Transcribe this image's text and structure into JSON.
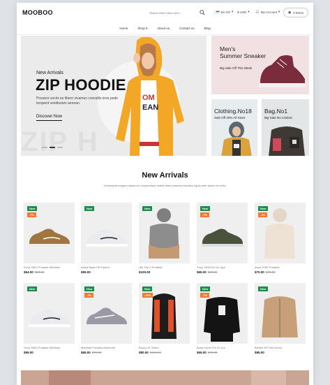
{
  "header": {
    "logo": "MOOBOO",
    "search_placeholder": "Search entire store here...",
    "language": "En-Gb",
    "currency": "$ USD",
    "account": "My Account",
    "wishlist": "0 Items"
  },
  "nav": [
    "Home",
    "Shop",
    "About us",
    "Contact us",
    "Blog"
  ],
  "hero": {
    "subtitle": "New Arrivals",
    "title": "ZIP HOODIE",
    "description": "Posuere sociis eu libero vivamus convallis eros pede torquent vestibulum aenean.",
    "button": "Discover Now",
    "ghost_text": "ZIP H"
  },
  "banners": [
    {
      "title": "Men's\nSummer Sneaker",
      "title_line1": "Men's",
      "title_line2": "Summer Sneaker",
      "subtitle": "Big Sale Off This Week"
    },
    {
      "title": "Clothing.No18",
      "subtitle": "Sale Off 20% All Store"
    },
    {
      "title": "Bag.No1",
      "subtitle": "Big Sale No Limited"
    }
  ],
  "section": {
    "title": "New Arrivals",
    "subtitle": "Consequat magna massa vel suspendisse mattis diam pharetra faucibus ligula ante ipsum ac nulla."
  },
  "products": [
    {
      "name": "Sony X800 Portable Wireless",
      "price": "$64.00",
      "old": "$88.00",
      "new": "New",
      "sale": "-7%",
      "icon": "brown-sneaker-icon"
    },
    {
      "name": "Nokia Basic HR Hybrid",
      "price": "$95.00",
      "old": "",
      "new": "New",
      "sale": "",
      "icon": "white-sneaker-icon"
    },
    {
      "name": "JBL Flip 5 Portable",
      "price": "$100.00",
      "old": "",
      "new": "New",
      "sale": "",
      "icon": "grey-hoodie-icon"
    },
    {
      "name": "Sony XB32/33 Ult Joyli",
      "price": "$65.00",
      "old": "$88.00",
      "new": "New",
      "sale": "-7%",
      "icon": "olive-sneaker-icon"
    },
    {
      "name": "Asus ZF8P Portable",
      "price": "$70.00",
      "old": "$75.00",
      "new": "New",
      "sale": "-7%",
      "icon": "cream-hoodie-icon"
    },
    {
      "name": "Sony X800 Portable Wireless",
      "price": "$95.00",
      "old": "",
      "new": "New",
      "sale": "",
      "icon": "white-sneaker-icon"
    },
    {
      "name": "Marshall Portable Bluetooth",
      "price": "$65.00",
      "old": "$70.00",
      "new": "New",
      "sale": "-7%",
      "icon": "grey-sneaker-icon"
    },
    {
      "name": "Bunny 67 Wired",
      "price": "$80.00",
      "old": "$100.00",
      "new": "New",
      "sale": "-20%",
      "icon": "puffer-vest-icon"
    },
    {
      "name": "Bose Home Pro Dr Dur",
      "price": "$65.00",
      "old": "$70.00",
      "new": "New",
      "sale": "-7%",
      "icon": "black-sweatshirt-icon"
    },
    {
      "name": "Beoble EP7460 Aeros",
      "price": "$95.00",
      "old": "",
      "new": "New",
      "sale": "",
      "icon": "tan-jacket-icon"
    }
  ],
  "colors": {
    "new_badge": "#1e8a4c",
    "sale_badge": "#f07a30",
    "hoodie": "#f2a726"
  }
}
